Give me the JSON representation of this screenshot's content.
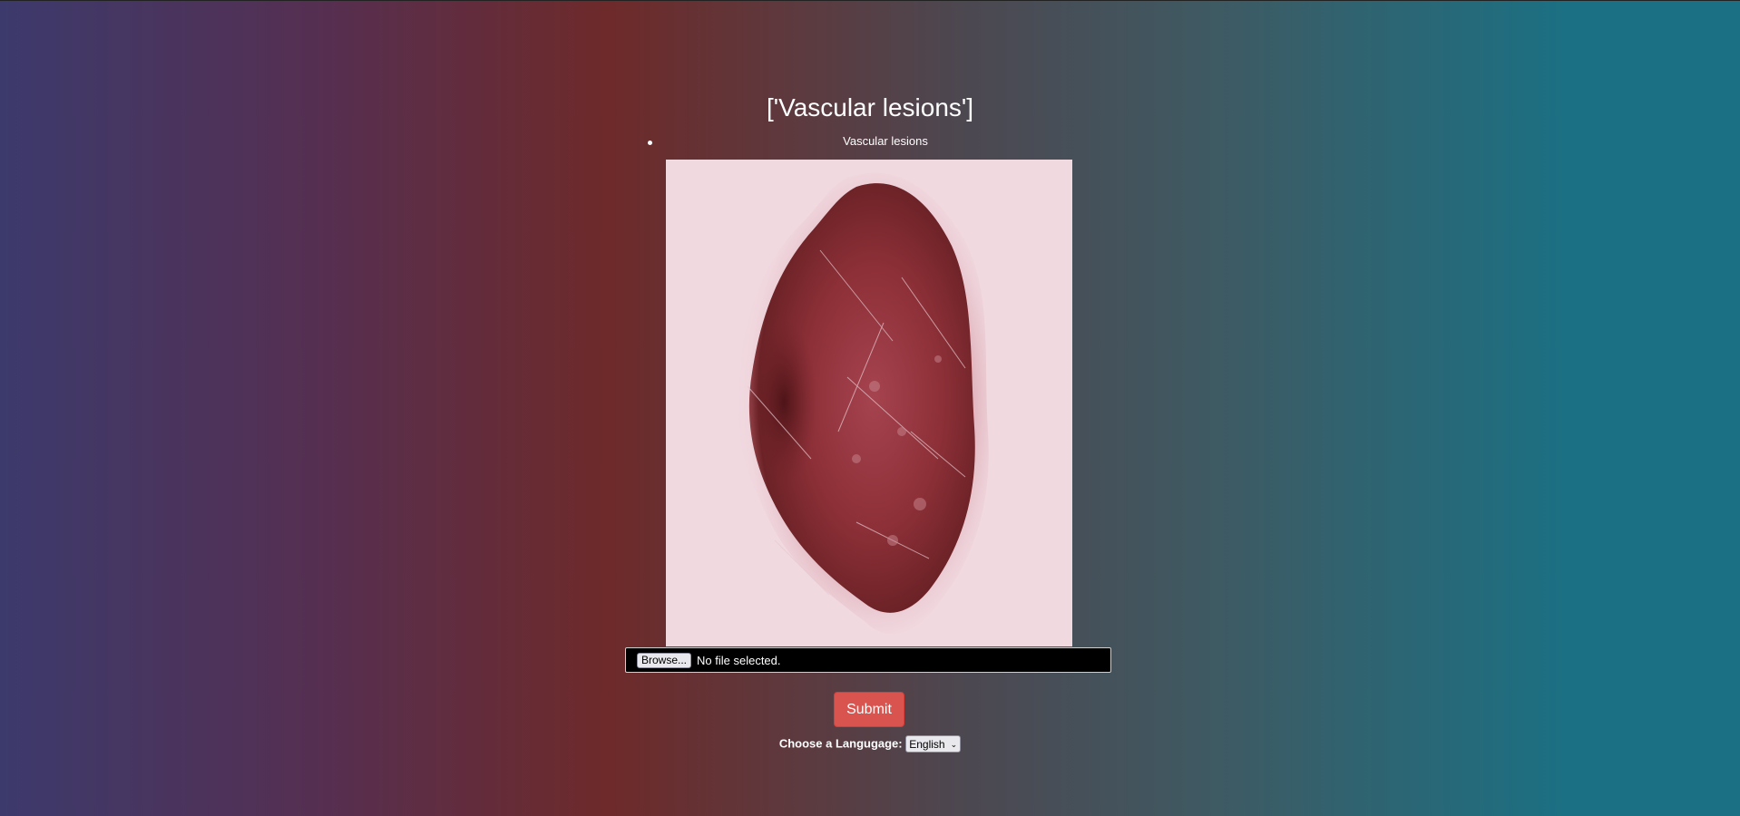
{
  "page": {
    "title": "['Vascular lesions']",
    "results": [
      "Vascular lesions"
    ]
  },
  "image": {
    "description_icon": "skin-lesion-image"
  },
  "upload": {
    "browse_label": "Browse...",
    "status_text": "No file selected."
  },
  "form": {
    "submit_label": "Submit"
  },
  "language": {
    "label": "Choose a Langugage:",
    "selected": "English"
  },
  "colors": {
    "submit_bg": "#d9534f",
    "gradient_left": "#3c3a6c",
    "gradient_mid": "#6e2a2a",
    "gradient_right": "#1b7083"
  }
}
